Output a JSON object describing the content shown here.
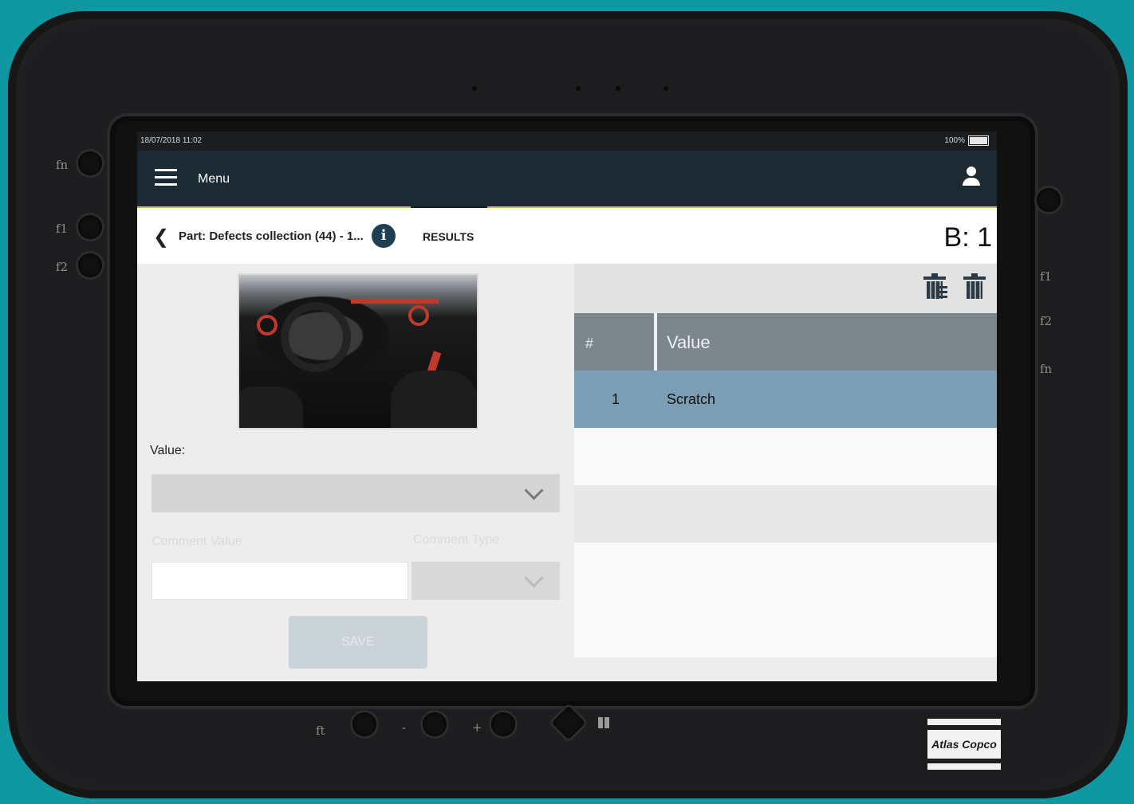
{
  "statusbar": {
    "datetime": "18/07/2018 11:02",
    "battery": "100%"
  },
  "appbar": {
    "menu_label": "Menu"
  },
  "toolbar": {
    "part_title": "Part: Defects collection (44) - 1...",
    "info_glyph": "i",
    "results_tab": "RESULTS",
    "batch": "B: 1"
  },
  "form": {
    "value_label": "Value:",
    "value_selected": "",
    "comment_label": "Comment Value",
    "comment_type_label": "Comment Type",
    "comment_value": "",
    "save_label": "SAVE"
  },
  "table": {
    "headers": [
      "#",
      "Value"
    ],
    "rows": [
      {
        "index": "1",
        "value": "Scratch"
      }
    ]
  },
  "hardware": {
    "left_labels": [
      "fn",
      "f1",
      "f2"
    ],
    "right_labels": [
      "f1",
      "f2",
      "fn"
    ],
    "bottom_labels": [
      "ft",
      "-",
      "+"
    ],
    "logo_text": "Atlas Copco"
  },
  "icons": {
    "menu": "hamburger-icon",
    "user": "user-icon",
    "back": "chevron-left-icon",
    "info": "info-icon",
    "delete_all": "trash-multiple-icon",
    "delete": "trash-icon",
    "dropdown": "chevron-down-icon"
  }
}
